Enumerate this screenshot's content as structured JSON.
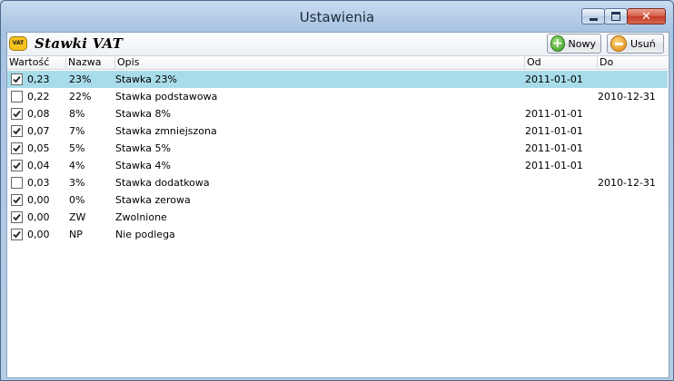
{
  "window": {
    "title": "Ustawienia"
  },
  "toolbar": {
    "icon_text": "VAT",
    "title": "Stawki VAT",
    "new_label": "Nowy",
    "delete_label": "Usuń"
  },
  "grid": {
    "columns": [
      "Wartość",
      "Nazwa",
      "Opis",
      "Od",
      "Do"
    ],
    "rows": [
      {
        "checked": true,
        "value": "0,23",
        "name": "23%",
        "desc": "Stawka 23%",
        "od": "2011-01-01",
        "do": "",
        "selected": true
      },
      {
        "checked": false,
        "value": "0,22",
        "name": "22%",
        "desc": "Stawka podstawowa",
        "od": "",
        "do": "2010-12-31",
        "selected": false
      },
      {
        "checked": true,
        "value": "0,08",
        "name": "8%",
        "desc": "Stawka 8%",
        "od": "2011-01-01",
        "do": "",
        "selected": false
      },
      {
        "checked": true,
        "value": "0,07",
        "name": "7%",
        "desc": "Stawka zmniejszona",
        "od": "2011-01-01",
        "do": "",
        "selected": false
      },
      {
        "checked": true,
        "value": "0,05",
        "name": "5%",
        "desc": "Stawka 5%",
        "od": "2011-01-01",
        "do": "",
        "selected": false
      },
      {
        "checked": true,
        "value": "0,04",
        "name": "4%",
        "desc": "Stawka 4%",
        "od": "2011-01-01",
        "do": "",
        "selected": false
      },
      {
        "checked": false,
        "value": "0,03",
        "name": "3%",
        "desc": "Stawka dodatkowa",
        "od": "",
        "do": "2010-12-31",
        "selected": false
      },
      {
        "checked": true,
        "value": "0,00",
        "name": "0%",
        "desc": "Stawka zerowa",
        "od": "",
        "do": "",
        "selected": false
      },
      {
        "checked": true,
        "value": "0,00",
        "name": "ZW",
        "desc": "Zwolnione",
        "od": "",
        "do": "",
        "selected": false
      },
      {
        "checked": true,
        "value": "0,00",
        "name": "NP",
        "desc": "Nie podlega",
        "od": "",
        "do": "",
        "selected": false
      }
    ]
  }
}
